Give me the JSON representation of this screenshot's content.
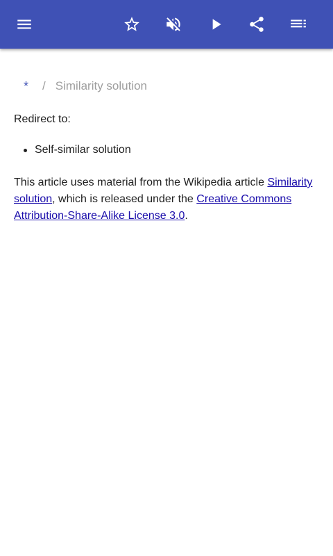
{
  "toolbar": {
    "icons": [
      "menu-icon",
      "star-outline-icon",
      "volume-off-icon",
      "play-icon",
      "share-icon",
      "playlist-icon"
    ],
    "color": "#3f51b5"
  },
  "breadcrumb": {
    "home": "*",
    "separator": "/",
    "current": "Similarity solution"
  },
  "article": {
    "redirect_label": "Redirect to:",
    "redirect_items": [
      "Self-similar solution"
    ],
    "license": {
      "prefix": "This article uses material from the Wikipedia article ",
      "article_link": "Similarity solution",
      "middle": ", which is released under the ",
      "license_link": "Creative Commons Attribution-Share-Alike License 3.0",
      "suffix": "."
    }
  }
}
